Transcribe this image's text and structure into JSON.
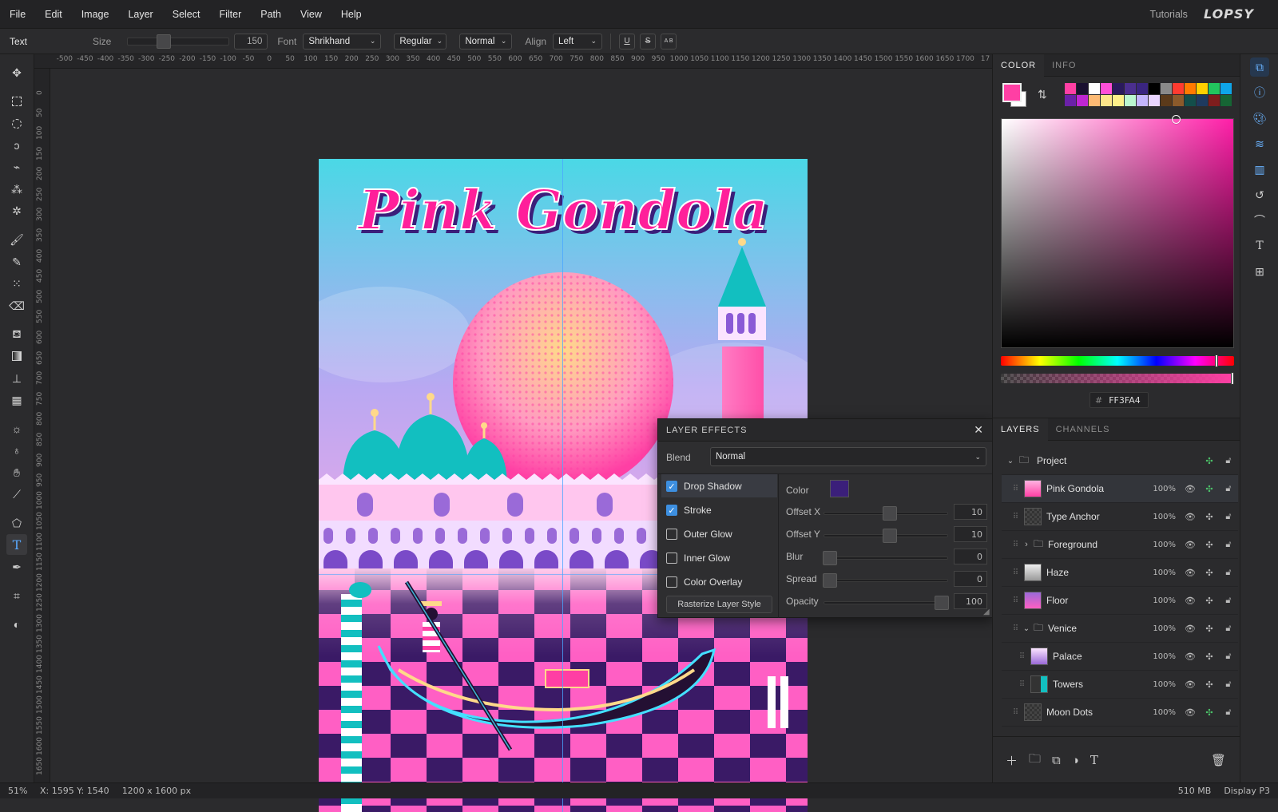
{
  "menu": {
    "items": [
      "File",
      "Edit",
      "Image",
      "Layer",
      "Select",
      "Filter",
      "Path",
      "View",
      "Help"
    ],
    "tutorials": "Tutorials",
    "logo": "LOPSY"
  },
  "options": {
    "tool_name": "Text",
    "size_label": "Size",
    "size_value": "150",
    "font_label": "Font",
    "font_value": "Shrikhand",
    "style_value": "Regular",
    "blend_value": "Normal",
    "align_label": "Align",
    "align_value": "Left",
    "underline": "U",
    "strike": "S",
    "ab": "A B"
  },
  "ruler_top": [
    "-500",
    "-450",
    "-400",
    "-350",
    "-300",
    "-250",
    "-200",
    "-150",
    "-100",
    "-50",
    "0",
    "50",
    "100",
    "150",
    "200",
    "250",
    "300",
    "350",
    "400",
    "450",
    "500",
    "550",
    "600",
    "650",
    "700",
    "750",
    "800",
    "850",
    "900",
    "950",
    "1000",
    "1050",
    "1100",
    "1150",
    "1200",
    "1250",
    "1300",
    "1350",
    "1400",
    "1450",
    "1500",
    "1550",
    "1600",
    "1650",
    "1700",
    "17"
  ],
  "ruler_left": [
    "0",
    "50",
    "100",
    "150",
    "200",
    "250",
    "300",
    "350",
    "400",
    "450",
    "500",
    "550",
    "600",
    "650",
    "700",
    "750",
    "800",
    "850",
    "900",
    "950",
    "1000",
    "1050",
    "1100",
    "1150",
    "1200",
    "1250",
    "1300",
    "1350",
    "1400",
    "1450",
    "1500",
    "1550",
    "1600",
    "1650"
  ],
  "artwork": {
    "title": "Pink Gondola"
  },
  "color_panel": {
    "tabs": [
      "COLOR",
      "INFO"
    ],
    "foreground": "#FF3FA4",
    "hex_prefix": "#",
    "hex_value": "FF3FA4",
    "swatches_row1": [
      "#ff3fa4",
      "#1a1030",
      "#ffffff",
      "#ff4fd8",
      "#2a1a5c",
      "#4b2f8f",
      "#3a2580",
      "#000000",
      "#8a8a8a",
      "#ff3b30",
      "#ff7a00",
      "#ffd000",
      "#22c55e",
      "#0ea5e9"
    ],
    "swatches_row2": [
      "#6b21a8",
      "#c026d3",
      "#fdba74",
      "#fde68a",
      "#fef08a",
      "#bbf7d0",
      "#c4b5fd",
      "#e9d5ff",
      "#5b3a1a",
      "#8b5a2b",
      "#134e4a",
      "#1e3a5f",
      "#7f1d1d",
      "#166534"
    ]
  },
  "layers_panel": {
    "tabs": [
      "LAYERS",
      "CHANNELS"
    ],
    "rows": [
      {
        "name": "Project",
        "opacity": "",
        "kind": "group-root"
      },
      {
        "name": "Pink Gondola",
        "opacity": "100%",
        "kind": "text",
        "selected": true
      },
      {
        "name": "Type Anchor",
        "opacity": "100%",
        "kind": "layer"
      },
      {
        "name": "Foreground",
        "opacity": "100%",
        "kind": "group"
      },
      {
        "name": "Haze",
        "opacity": "100%",
        "kind": "layer"
      },
      {
        "name": "Floor",
        "opacity": "100%",
        "kind": "layer"
      },
      {
        "name": "Venice",
        "opacity": "100%",
        "kind": "group-open"
      },
      {
        "name": "Palace",
        "opacity": "100%",
        "kind": "child"
      },
      {
        "name": "Towers",
        "opacity": "100%",
        "kind": "child"
      },
      {
        "name": "Moon Dots",
        "opacity": "100%",
        "kind": "layer"
      }
    ]
  },
  "layer_effects": {
    "title": "LAYER EFFECTS",
    "blend_label": "Blend",
    "blend_value": "Normal",
    "effects": [
      {
        "label": "Drop Shadow",
        "checked": true
      },
      {
        "label": "Stroke",
        "checked": true
      },
      {
        "label": "Outer Glow",
        "checked": false
      },
      {
        "label": "Inner Glow",
        "checked": false
      },
      {
        "label": "Color Overlay",
        "checked": false
      }
    ],
    "rasterize_label": "Rasterize Layer Style",
    "color_label": "Color",
    "shadow_color": "#3b1f7a",
    "params": [
      {
        "label": "Offset X",
        "value": "10"
      },
      {
        "label": "Offset Y",
        "value": "10"
      },
      {
        "label": "Blur",
        "value": "0"
      },
      {
        "label": "Spread",
        "value": "0"
      },
      {
        "label": "Opacity",
        "value": "100"
      }
    ]
  },
  "status": {
    "zoom": "51%",
    "cursor": "X: 1595 Y: 1540",
    "doc_size": "1200 x 1600 px",
    "memory": "510 MB",
    "profile": "Display P3"
  }
}
